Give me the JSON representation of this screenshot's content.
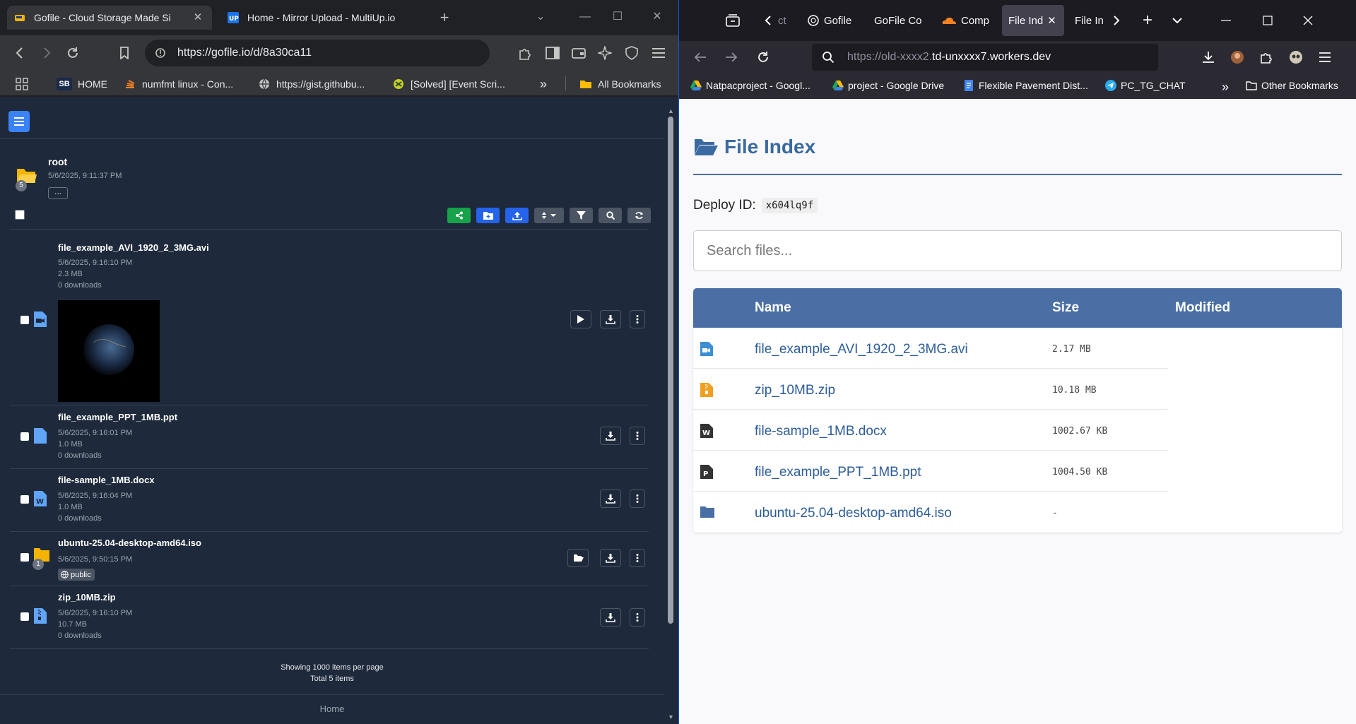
{
  "left_browser": {
    "tabs": [
      {
        "title": "Gofile - Cloud Storage Made Si",
        "active": true
      },
      {
        "title": "Home - Mirror Upload - MultiUp.io",
        "active": false
      }
    ],
    "address": "https://gofile.io/d/8a30ca11",
    "bookmarks": [
      {
        "label": "HOME",
        "icon": "SB"
      },
      {
        "label": "numfmt linux - Con..."
      },
      {
        "label": "https://gist.githubu..."
      },
      {
        "label": "[Solved] [Event Scri..."
      },
      {
        "label": "All Bookmarks"
      }
    ]
  },
  "gofile": {
    "root": {
      "title": "root",
      "date": "5/6/2025, 9:11:37 PM",
      "count_badge": "5",
      "more_label": "..."
    },
    "files": [
      {
        "name": "file_example_AVI_1920_2_3MG.avi",
        "date": "5/6/2025, 9:16:10 PM",
        "size": "2.3 MB",
        "downloads": "0 downloads"
      },
      {
        "name": "file_example_PPT_1MB.ppt",
        "date": "5/6/2025, 9:16:01 PM",
        "size": "1.0 MB",
        "downloads": "0 downloads"
      },
      {
        "name": "file-sample_1MB.docx",
        "date": "5/6/2025, 9:16:04 PM",
        "size": "1.0 MB",
        "downloads": "0 downloads"
      },
      {
        "name": "ubuntu-25.04-desktop-amd64.iso",
        "date": "5/6/2025, 9:50:15 PM",
        "badge": "public",
        "count_badge": "1"
      },
      {
        "name": "zip_10MB.zip",
        "date": "5/6/2025, 9:16:10 PM",
        "size": "10.7 MB",
        "downloads": "0 downloads"
      }
    ],
    "footer_line1": "Showing 1000 items per page",
    "footer_line2": "Total 5 items",
    "home_label": "Home",
    "colors": {
      "bg": "#1e293b",
      "share": "#16a34a",
      "primary": "#2563eb"
    }
  },
  "right_browser": {
    "tabs": [
      {
        "title": "ct"
      },
      {
        "title": "Gofile"
      },
      {
        "title": "GoFile Co"
      },
      {
        "title": "Comp"
      },
      {
        "title": "File Ind",
        "active": true
      },
      {
        "title": "File In"
      }
    ],
    "address_grey": "https://old-xxxx2.",
    "address_main": "td-unxxxx7.workers.dev",
    "bookmarks": [
      {
        "label": "Natpacproject - Googl..."
      },
      {
        "label": "project - Google Drive"
      },
      {
        "label": "Flexible Pavement Dist..."
      },
      {
        "label": "PC_TG_CHAT"
      },
      {
        "label": "Other Bookmarks"
      }
    ]
  },
  "file_index": {
    "title": "File Index",
    "deploy_label": "Deploy ID:",
    "deploy_id": "x604lq9f",
    "search_placeholder": "Search files...",
    "columns": {
      "name": "Name",
      "size": "Size",
      "modified": "Modified"
    },
    "rows": [
      {
        "name": "file_example_AVI_1920_2_3MG.avi",
        "size": "2.17 MB",
        "icon": "video-file-icon"
      },
      {
        "name": "zip_10MB.zip",
        "size": "10.18 MB",
        "icon": "zip-file-icon"
      },
      {
        "name": "file-sample_1MB.docx",
        "size": "1002.67 KB",
        "icon": "word-file-icon"
      },
      {
        "name": "file_example_PPT_1MB.ppt",
        "size": "1004.50 KB",
        "icon": "ppt-file-icon"
      },
      {
        "name": "ubuntu-25.04-desktop-amd64.iso",
        "size": "-",
        "icon": "folder-icon"
      }
    ],
    "colors": {
      "accent": "#4a6fa5",
      "link": "#2d5d9a"
    }
  }
}
